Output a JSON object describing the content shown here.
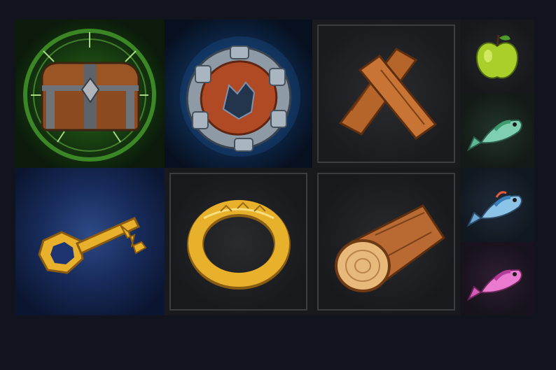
{
  "inventory": {
    "items": [
      {
        "icon": "treasure-chest-icon",
        "rarity_glow": "#5fd13a"
      },
      {
        "icon": "wolf-shield-icon",
        "rarity_glow": "#2f7fd8"
      },
      {
        "icon": "wooden-planks-icon"
      },
      {
        "icon": "green-apple-icon"
      },
      {
        "icon": "green-fish-icon"
      },
      {
        "icon": "golden-key-icon",
        "rarity_glow": "#3a64b8"
      },
      {
        "icon": "golden-ring-icon"
      },
      {
        "icon": "wood-log-icon"
      },
      {
        "icon": "blue-fish-icon"
      },
      {
        "icon": "pink-fish-icon"
      }
    ]
  },
  "colors": {
    "background": "#12141d",
    "slot_border": "#3b3d42",
    "gold": "#e8b12c",
    "wood": "#b5652a"
  }
}
